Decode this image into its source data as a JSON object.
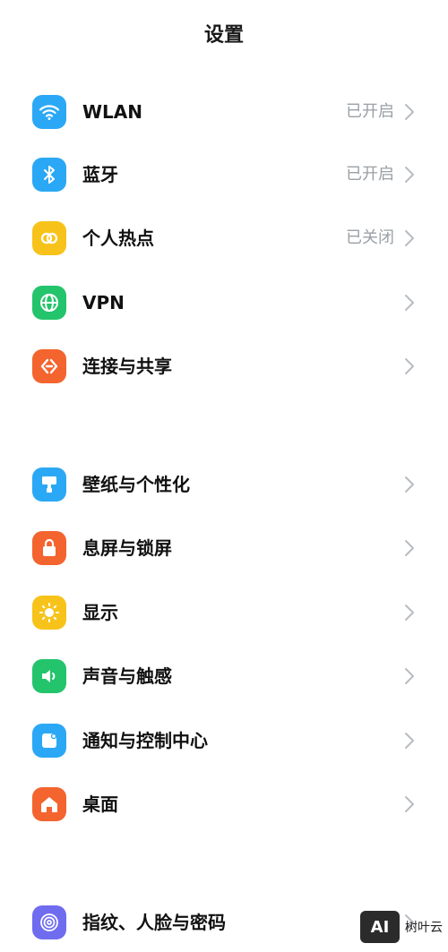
{
  "header": {
    "title": "设置"
  },
  "rows": [
    {
      "label": "WLAN",
      "status": "已开启",
      "icon": "wifi-icon",
      "color": "#2BA8F5"
    },
    {
      "label": "蓝牙",
      "status": "已开启",
      "icon": "bluetooth-icon",
      "color": "#2BA8F5"
    },
    {
      "label": "个人热点",
      "status": "已关闭",
      "icon": "hotspot-icon",
      "color": "#F7C31B"
    },
    {
      "label": "VPN",
      "status": "",
      "icon": "globe-icon",
      "color": "#23C46B"
    },
    {
      "label": "连接与共享",
      "status": "",
      "icon": "share-icon",
      "color": "#F3642E"
    },
    {
      "label": "壁纸与个性化",
      "status": "",
      "icon": "brush-icon",
      "color": "#2BA8F5"
    },
    {
      "label": "息屏与锁屏",
      "status": "",
      "icon": "lock-icon",
      "color": "#F3642E"
    },
    {
      "label": "显示",
      "status": "",
      "icon": "sun-icon",
      "color": "#F7C31B"
    },
    {
      "label": "声音与触感",
      "status": "",
      "icon": "speaker-icon",
      "color": "#23C46B"
    },
    {
      "label": "通知与控制中心",
      "status": "",
      "icon": "notification-icon",
      "color": "#2BA8F5"
    },
    {
      "label": "桌面",
      "status": "",
      "icon": "home-icon",
      "color": "#F3642E"
    },
    {
      "label": "指纹、人脸与密码",
      "status": "",
      "icon": "fingerprint-icon",
      "color": "#6F6CF0"
    }
  ],
  "watermark": {
    "logo": "AI",
    "text": "树叶云"
  }
}
